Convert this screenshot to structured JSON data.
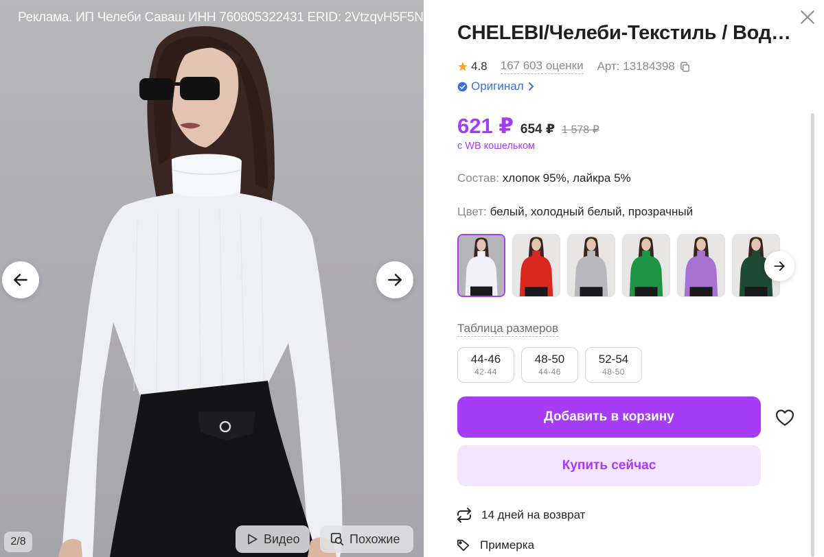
{
  "gallery": {
    "ad_label": "Реклама. ИП Челеби Саваш ИНН 760805322431 ERID: 2VtzqvH5F5N",
    "counter": "2/8",
    "video_label": "Видео",
    "similar_label": "Похожие"
  },
  "product": {
    "title": "CHELEBI/Челеби-Текстиль / Водолазка",
    "rating": "4.8",
    "reviews": "167 603 оценки",
    "article": "Арт: 13184398",
    "original_label": "Оригинал",
    "price_main": "621 ₽",
    "price_wb": "654 ₽",
    "price_old": "1 578 ₽",
    "wallet_note": "с WB кошельком",
    "composition_label": "Состав:",
    "composition_value": "хлопок 95%, лайкра 5%",
    "color_label": "Цвет:",
    "color_value": "белый, холодный белый, прозрачный",
    "swatches": [
      {
        "color": "#f2f2f6",
        "name": "white"
      },
      {
        "color": "#d9281f",
        "name": "red"
      },
      {
        "color": "#b9b9bd",
        "name": "grey"
      },
      {
        "color": "#1e9446",
        "name": "green"
      },
      {
        "color": "#a772d1",
        "name": "lilac"
      },
      {
        "color": "#1f4a33",
        "name": "dark-green"
      }
    ],
    "size_table_label": "Таблица размеров",
    "sizes": [
      {
        "size": "44-46",
        "ru": "42-44"
      },
      {
        "size": "48-50",
        "ru": "44-46"
      },
      {
        "size": "52-54",
        "ru": "48-50"
      }
    ],
    "add_to_cart": "Добавить в корзину",
    "buy_now": "Купить сейчас",
    "return_label": "14 дней на возврат",
    "tryon_label": "Примерка"
  },
  "colors": {
    "accent": "#a73afd",
    "cart_button": "#a63cf6",
    "buy_button_bg": "#f5e4fd",
    "rating_star": "#f5a623",
    "original_blue": "#3a6fd8"
  },
  "icons": {
    "close": "close-icon",
    "star": "star-icon",
    "copy": "copy-icon",
    "verified": "verified-check-icon",
    "chevron": "chevron-right-icon",
    "arrow_left": "arrow-left-icon",
    "arrow_right": "arrow-right-icon",
    "play": "play-icon",
    "similar": "search-similar-icon",
    "heart": "heart-icon",
    "return": "return-arrows-icon",
    "tag": "tag-icon"
  }
}
